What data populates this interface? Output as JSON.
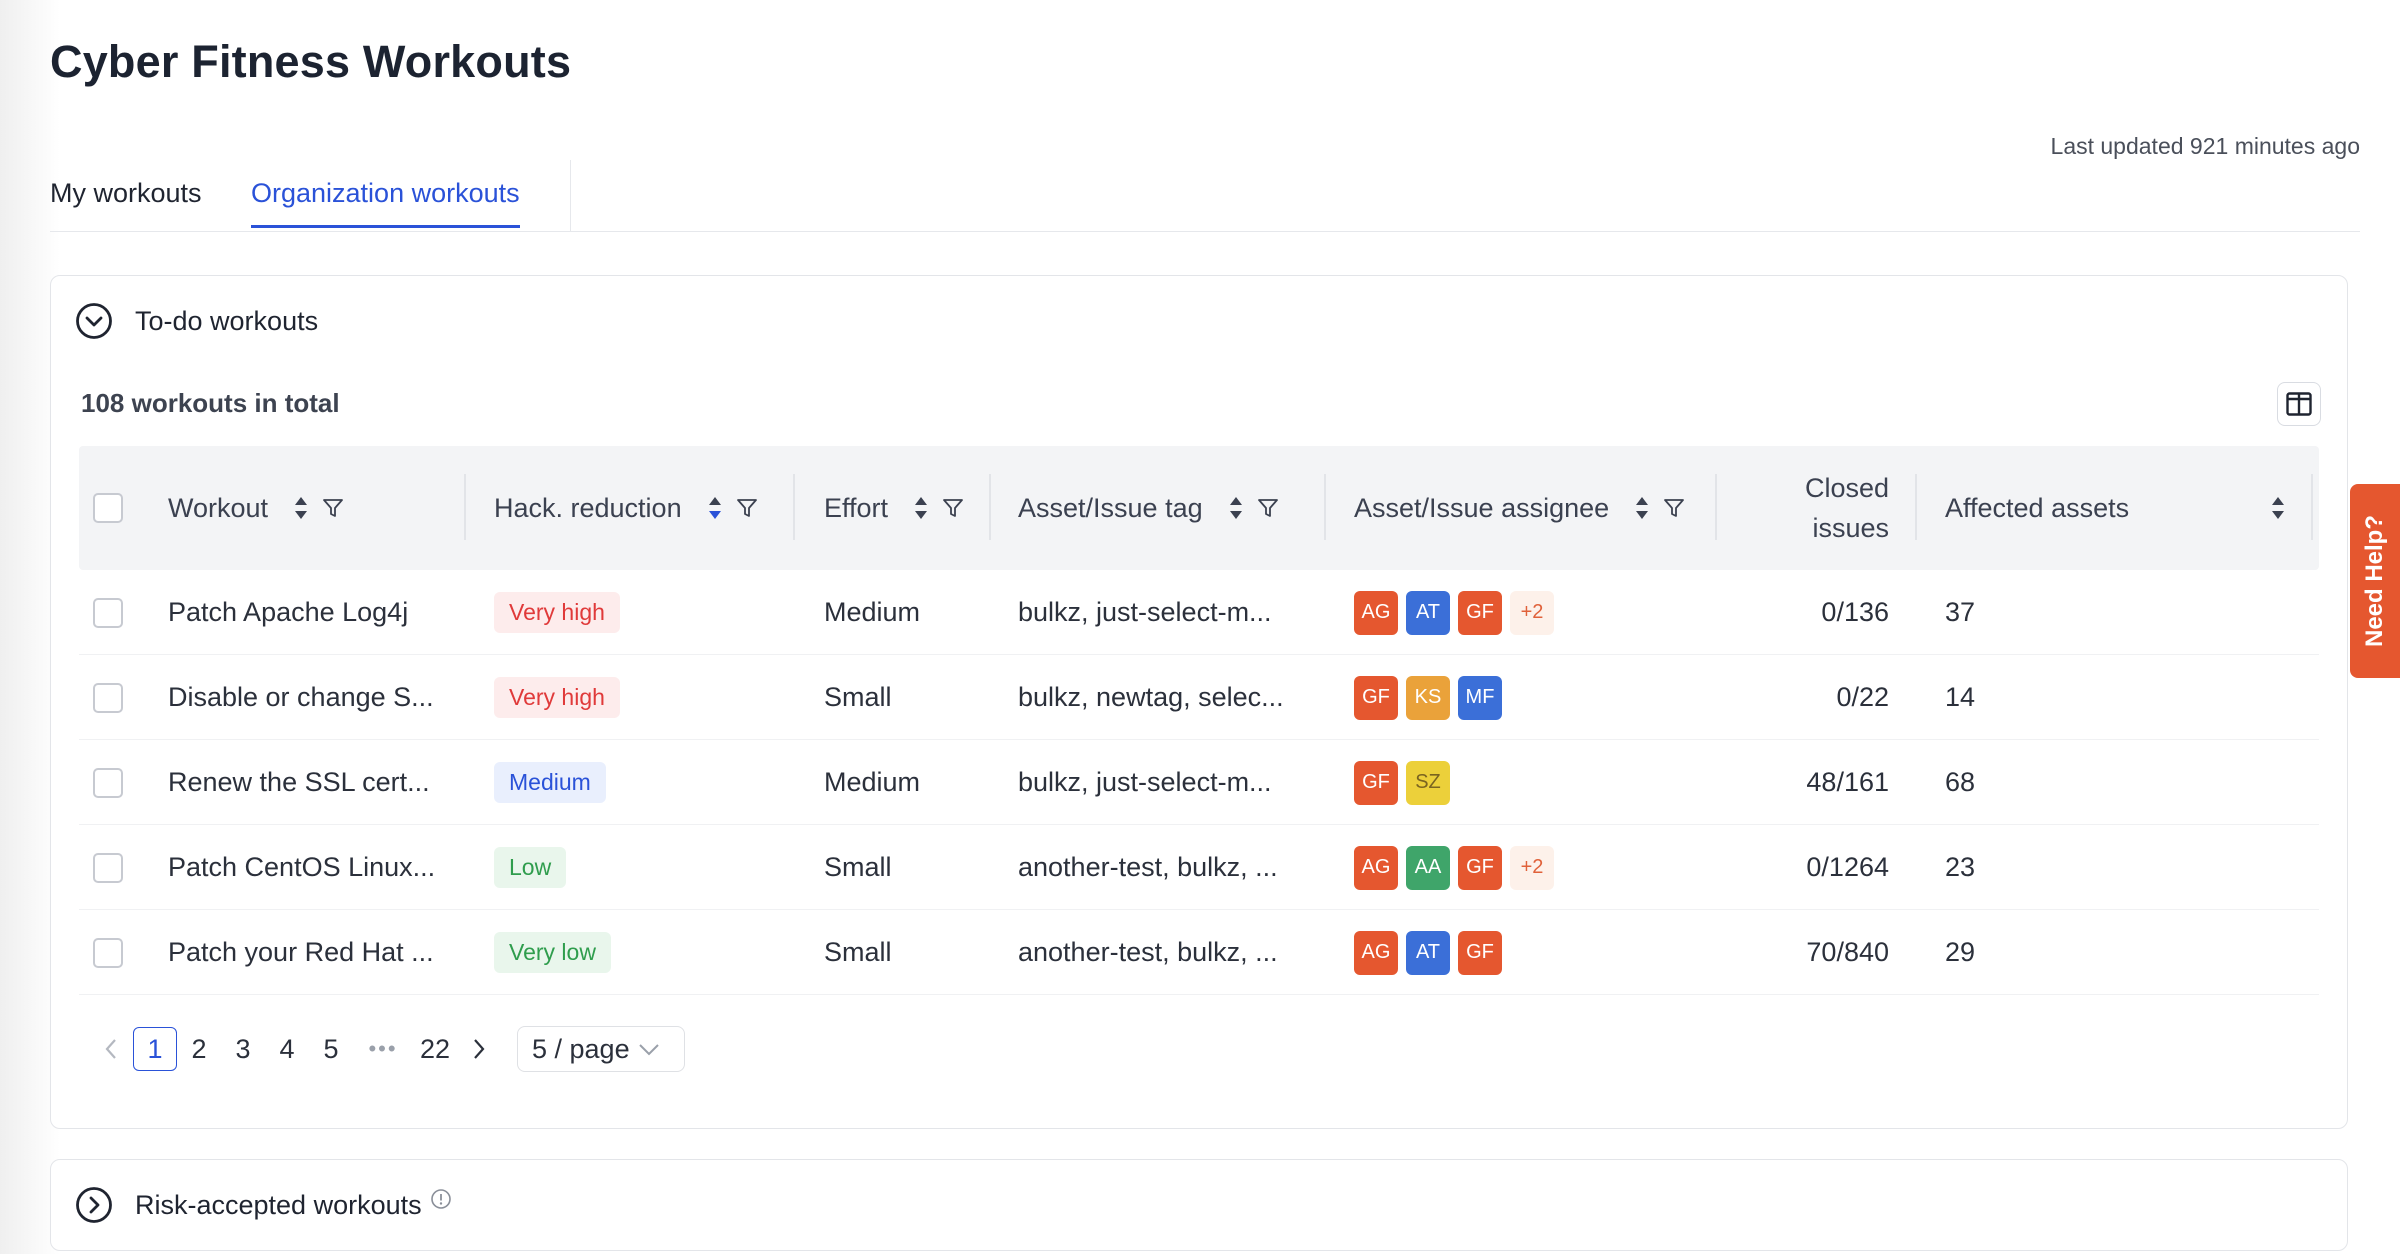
{
  "page_title": "Cyber Fitness Workouts",
  "last_updated": "Last updated 921 minutes ago",
  "tabs": [
    {
      "label": "My workouts",
      "active": false
    },
    {
      "label": "Organization workouts",
      "active": true
    }
  ],
  "todo": {
    "section_label": "To-do workouts",
    "total_text": "108 workouts in total",
    "columns": {
      "workout": "Workout",
      "hack_reduction": "Hack. reduction",
      "effort": "Effort",
      "tag": "Asset/Issue tag",
      "assignee": "Asset/Issue assignee",
      "closed_line1": "Closed",
      "closed_line2": "issues",
      "affected": "Affected assets"
    },
    "rows": [
      {
        "workout": "Patch Apache Log4j",
        "hack": "Very high",
        "effort": "Medium",
        "tag": "bulkz, just-select-m...",
        "assignees": [
          "AG",
          "AT",
          "GF"
        ],
        "more": "+2",
        "closed": "0/136",
        "affected": "37"
      },
      {
        "workout": "Disable or change S...",
        "hack": "Very high",
        "effort": "Small",
        "tag": "bulkz, newtag, selec...",
        "assignees": [
          "GF",
          "KS",
          "MF"
        ],
        "more": "",
        "closed": "0/22",
        "affected": "14"
      },
      {
        "workout": "Renew the SSL cert...",
        "hack": "Medium",
        "effort": "Medium",
        "tag": "bulkz, just-select-m...",
        "assignees": [
          "GF",
          "SZ"
        ],
        "more": "",
        "closed": "48/161",
        "affected": "68"
      },
      {
        "workout": "Patch CentOS Linux...",
        "hack": "Low",
        "effort": "Small",
        "tag": "another-test, bulkz, ...",
        "assignees": [
          "AG",
          "AA",
          "GF"
        ],
        "more": "+2",
        "closed": "0/1264",
        "affected": "23"
      },
      {
        "workout": "Patch your Red Hat ...",
        "hack": "Very low",
        "effort": "Small",
        "tag": "another-test, bulkz, ...",
        "assignees": [
          "AG",
          "AT",
          "GF"
        ],
        "more": "",
        "closed": "70/840",
        "affected": "29"
      }
    ],
    "pagination": {
      "pages": [
        "1",
        "2",
        "3",
        "4",
        "5"
      ],
      "ellipsis": "•••",
      "last": "22",
      "page_size": "5 / page"
    }
  },
  "risk": {
    "section_label": "Risk-accepted workouts"
  },
  "help_tab": "Need Help?",
  "colors": {
    "accent": "#2a52d8",
    "help": "#e5572f",
    "avatar_AG": "#e5572f",
    "avatar_AT": "#3b6fd8",
    "avatar_GF": "#e5572f",
    "avatar_KS": "#eaa23a",
    "avatar_MF": "#3b6fd8",
    "avatar_SZ": "#ecd03a",
    "avatar_AA": "#3fa56a"
  },
  "icons": [
    "chevron-down-circle-icon",
    "chevron-right-circle-icon",
    "sort-icon",
    "filter-icon",
    "columns-icon",
    "info-icon",
    "chevron-left-icon",
    "chevron-right-icon",
    "chevron-down-icon"
  ]
}
